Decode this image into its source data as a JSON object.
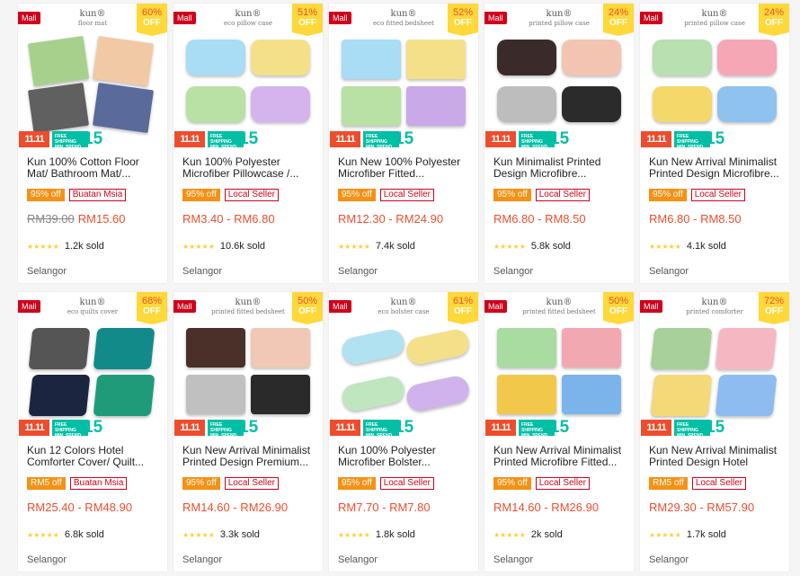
{
  "labels": {
    "mall": "Mall",
    "off": "OFF",
    "banner_1111": "11.11",
    "banner_free": "FREE SHIPPING",
    "banner_minspend": "MIN. SPEND",
    "banner_15": "15"
  },
  "colors": {
    "accent": "#ee4d2d",
    "mall": "#d0011b",
    "discount_tag": "#f69113",
    "badge": "#ffd839",
    "free_shipping": "#00bfa5",
    "stars": "#ffce3d"
  },
  "products": [
    {
      "brand": "kun",
      "subtitle": "floor mat",
      "discount": "60%",
      "title": "Kun 100% Cotton Floor Mat/ Bathroom Mat/...",
      "tag_discount": "95% off",
      "tag_seller": "Buatan Msia",
      "original_price": "RM39.00",
      "price": "RM15.60",
      "sold": "1.2k sold",
      "location": "Selangor",
      "swatches": [
        "#a8d08d",
        "#f2c9a5",
        "#606060",
        "#5a6a9a"
      ],
      "shape": "mat"
    },
    {
      "brand": "kun",
      "subtitle": "eco pillow case",
      "discount": "51%",
      "title": "Kun 100% Polyester Microfiber Pillowcase /...",
      "tag_discount": "95% off",
      "tag_seller": "Local Seller",
      "original_price": "",
      "price": "RM3.40 - RM6.80",
      "sold": "10.6k sold",
      "location": "Selangor",
      "swatches": [
        "#a9dcf5",
        "#f5e08a",
        "#b9e0a5",
        "#d5b3ec"
      ],
      "shape": "pillow"
    },
    {
      "brand": "kun",
      "subtitle": "eco fitted bedsheet",
      "discount": "52%",
      "title": "Kun New 100% Polyester Microfiber Fitted...",
      "tag_discount": "95% off",
      "tag_seller": "Local Seller",
      "original_price": "",
      "price": "RM12.30 - RM24.90",
      "sold": "7.4k sold",
      "location": "Selangor",
      "swatches": [
        "#a9dcf5",
        "#f5e08a",
        "#b9e0a5",
        "#c9a9e8"
      ],
      "shape": "sheet"
    },
    {
      "brand": "kun",
      "subtitle": "printed pillow case",
      "discount": "24%",
      "title": "Kun Minimalist Printed Design Microfibre...",
      "tag_discount": "95% off",
      "tag_seller": "Local Seller",
      "original_price": "",
      "price": "RM6.80 - RM8.50",
      "sold": "5.8k sold",
      "location": "Selangor",
      "swatches": [
        "#3a2a2a",
        "#f3c5b0",
        "#bdbdbd",
        "#2b2b2b"
      ],
      "shape": "pillow"
    },
    {
      "brand": "kun",
      "subtitle": "printed pillow case",
      "discount": "24%",
      "title": "Kun New Arrival Minimalist Printed Design Microfibre...",
      "tag_discount": "95% off",
      "tag_seller": "Local Seller",
      "original_price": "",
      "price": "RM6.80 - RM8.50",
      "sold": "4.1k sold",
      "location": "Selangor",
      "swatches": [
        "#b8e0b0",
        "#f5a7b5",
        "#f5d86a",
        "#8fc2ee"
      ],
      "shape": "pillow"
    },
    {
      "brand": "kun",
      "subtitle": "eco quilts cover",
      "discount": "68%",
      "title": "Kun 12 Colors Hotel Comforter Cover/ Quilt...",
      "tag_discount": "RM5 off",
      "tag_seller": "Buatan Msia",
      "original_price": "",
      "price": "RM25.40 - RM48.90",
      "sold": "6.8k sold",
      "location": "Selangor",
      "swatches": [
        "#555555",
        "#138a8a",
        "#1b2540",
        "#1f9b7a"
      ],
      "shape": "quilt"
    },
    {
      "brand": "kun",
      "subtitle": "printed fitted bedsheet",
      "discount": "50%",
      "title": "Kun New Arrival Minimalist Printed Design Premium...",
      "tag_discount": "95% off",
      "tag_seller": "Local Seller",
      "original_price": "",
      "price": "RM14.60 - RM26.90",
      "sold": "3.3k sold",
      "location": "Selangor",
      "swatches": [
        "#4a3028",
        "#f0c8b5",
        "#c0c0c0",
        "#2a2a2a"
      ],
      "shape": "sheet"
    },
    {
      "brand": "kun",
      "subtitle": "eco bolster case",
      "discount": "61%",
      "title": "Kun 100% Polyester Microfiber Bolster...",
      "tag_discount": "95% off",
      "tag_seller": "Local Seller",
      "original_price": "",
      "price": "RM7.70 - RM7.80",
      "sold": "1.8k sold",
      "location": "Selangor",
      "swatches": [
        "#b0e2f2",
        "#f5e08a",
        "#c0e6c0",
        "#d0b2ec"
      ],
      "shape": "bolster"
    },
    {
      "brand": "kun",
      "subtitle": "printed fitted bedsheet",
      "discount": "50%",
      "title": "Kun New Arrival Minimalist Printed Microfibre Fitted...",
      "tag_discount": "95% off",
      "tag_seller": "Local Seller",
      "original_price": "",
      "price": "RM14.60 - RM26.90",
      "sold": "2k sold",
      "location": "Selangor",
      "swatches": [
        "#a8dca0",
        "#f2a8b0",
        "#f2c84a",
        "#7ab4ea"
      ],
      "shape": "sheet"
    },
    {
      "brand": "kun",
      "subtitle": "printed comforter",
      "discount": "72%",
      "title": "Kun New Arrival Minimalist Printed Design Hotel Quilt...",
      "tag_discount": "RM5 off",
      "tag_seller": "Local Seller",
      "original_price": "",
      "price": "RM29.30 - RM57.90",
      "sold": "1.7k sold",
      "location": "Selangor",
      "swatches": [
        "#a8d09a",
        "#f5b8c2",
        "#f5d878",
        "#8ebcf0"
      ],
      "shape": "quilt"
    }
  ]
}
